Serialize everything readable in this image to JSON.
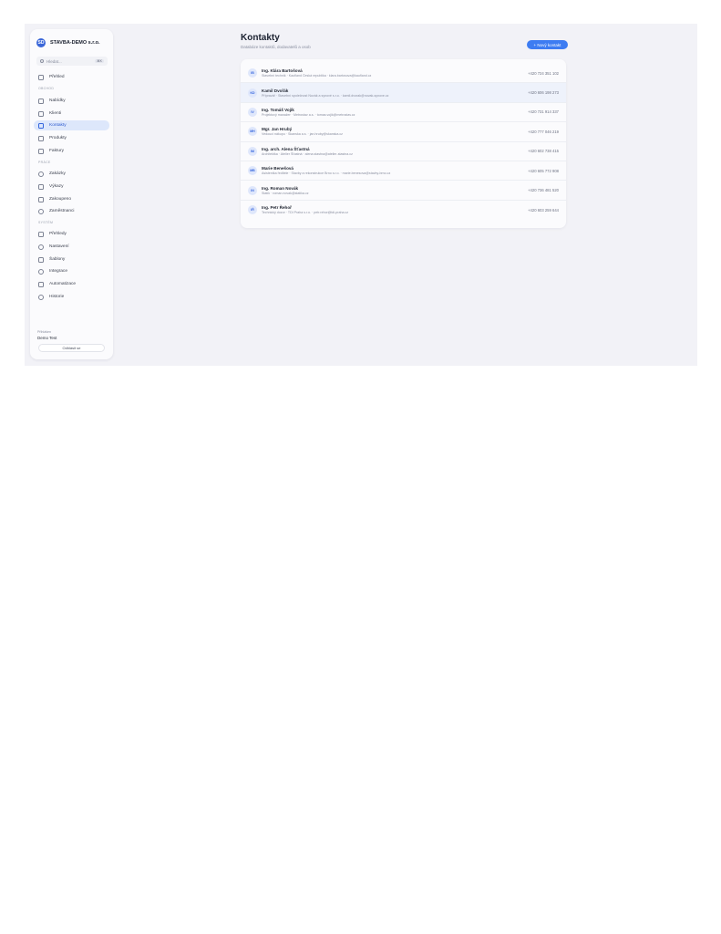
{
  "brand": {
    "logo": "SD",
    "name": "STAVBA-DEMO s.r.o."
  },
  "search": {
    "placeholder": "Hledat...",
    "shortcut": "⌘K"
  },
  "nav": {
    "home": "Přehled",
    "section_sales": "OBCHOD",
    "sales_items": [
      "Nabídky",
      "Klienti",
      "Kontakty",
      "Produkty",
      "Faktury"
    ],
    "section_work": "PRÁCE",
    "work_items": [
      "Zakázky",
      "Výkazy",
      "Zakoupeno",
      "Zaměstnanci"
    ],
    "section_system": "SYSTÉM",
    "system_items": [
      "Přehledy",
      "Nastavení",
      "Šablony",
      "Integrace",
      "Automatizace",
      "Historie"
    ]
  },
  "user": {
    "label": "Přihlášen",
    "name": "Demo Test",
    "logout": "Odhlásit se"
  },
  "header": {
    "title": "Kontakty",
    "subtitle": "Databáze kontaktů, dodavatelů a osob",
    "new_button": "+ Nový kontakt"
  },
  "contacts": [
    {
      "initials": "IB",
      "name": "Ing. Klára Bartošová",
      "detail": "Stavební technik · Kaufland Česká republika · klara.bartosova@kaufland.cz",
      "phone": "+420 724 351 102"
    },
    {
      "initials": "KD",
      "name": "Kamil Dvořák",
      "detail": "Přípravář · Stavební společnost Novák a synové s.r.o. · kamil.dvorak@novak-synove.cz",
      "phone": "+420 606 198 273"
    },
    {
      "initials": "IV",
      "name": "Ing. Tomáš Vojík",
      "detail": "Projektový manažer · Metrostav a.s. · tomas.vojik@metrostav.cz",
      "phone": "+420 731 914 337"
    },
    {
      "initials": "MH",
      "name": "Mgr. Jan Hrubý",
      "detail": "Vedoucí nákupu · Skanska a.s. · jan.hruby@skanska.cz",
      "phone": "+420 777 046 219"
    },
    {
      "initials": "IM",
      "name": "Ing. arch. Alena Šťastná",
      "detail": "Architektka · Atelier Šťastná · alena.stastna@atelier-stastna.cz",
      "phone": "+420 602 738 415"
    },
    {
      "initials": "MB",
      "name": "Marie Benešová",
      "detail": "Asistentka ředitele · Stavby a rekonstrukce Brno s.r.o. · marie.benesova@stavby-brno.cz",
      "phone": "+420 605 772 908"
    },
    {
      "initials": "IN",
      "name": "Ing. Roman Novák",
      "detail": "Statik · roman.novak@statika.cz",
      "phone": "+420 736 481 520"
    },
    {
      "initials": "IŘ",
      "name": "Ing. Petr Řehoř",
      "detail": "Technický dozor · TDI Praha s.r.o. · petr.rehor@tdi-praha.cz",
      "phone": "+420 603 259 644"
    }
  ]
}
